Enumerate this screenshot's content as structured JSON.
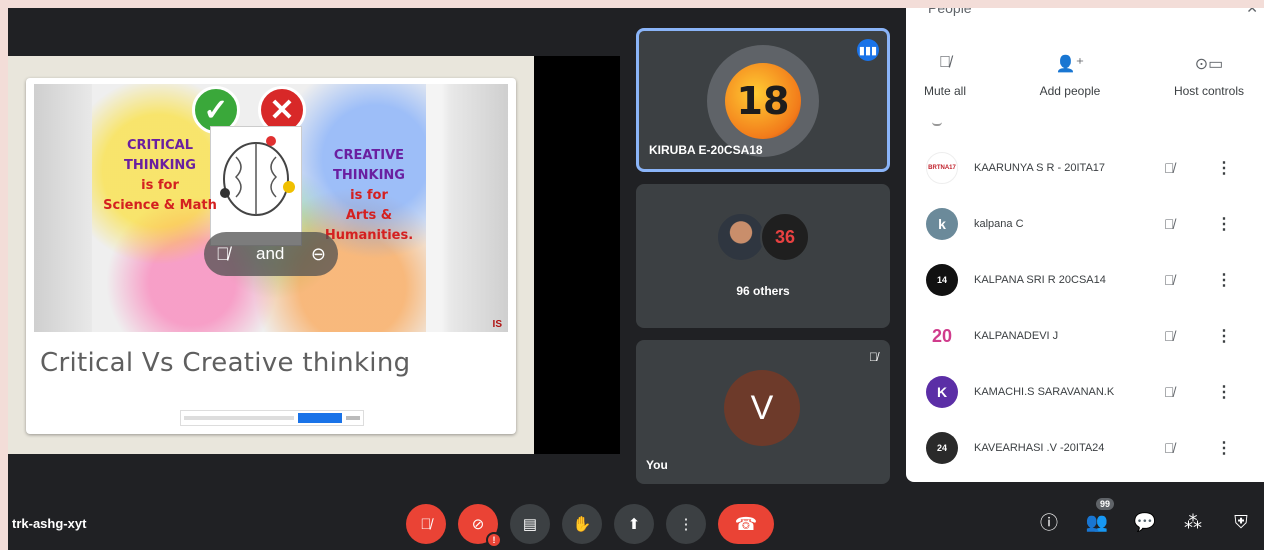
{
  "meeting": {
    "code": "trk-ashg-xyt"
  },
  "presentation": {
    "left_lines": [
      "CRITICAL",
      "THINKING",
      "is for",
      "Science & Math"
    ],
    "right_lines": [
      "CREATIVE",
      "THINKING",
      "is for",
      "Arts &",
      "Humanities."
    ],
    "pill_label": "and",
    "corner_mark": "IS",
    "title": "Critical Vs Creative thinking"
  },
  "tiles": {
    "speaker": {
      "name": "KIRUBA E-20CSA18",
      "avatar_text": "18"
    },
    "others": {
      "label": "96 others",
      "avatar_text": "36"
    },
    "self": {
      "name": "You",
      "avatar_letter": "V"
    }
  },
  "people_panel": {
    "title": "People",
    "actions": [
      {
        "label": "Mute all",
        "icon": "mic-off-icon"
      },
      {
        "label": "Add people",
        "icon": "person-add-icon"
      },
      {
        "label": "Host controls",
        "icon": "toggle-icon"
      }
    ],
    "participants": [
      {
        "name": "KAARUNYA S R - 20ITA17",
        "avatar": "BRTNA17",
        "color": "#ffffff",
        "text_color": "#c0202b"
      },
      {
        "name": "kalpana C",
        "avatar": "k",
        "color": "#6b8a9a",
        "text_color": "#ffffff"
      },
      {
        "name": "KALPANA SRI R 20CSA14",
        "avatar": "14",
        "color": "#111111",
        "text_color": "#ffffff"
      },
      {
        "name": "KALPANADEVI J",
        "avatar": "20",
        "color": "#ffffff",
        "text_color": "#d03c8c"
      },
      {
        "name": "KAMACHI.S SARAVANAN.K",
        "avatar": "K",
        "color": "#5b2ea6",
        "text_color": "#ffffff"
      },
      {
        "name": "KAVEARHASI .V -20ITA24",
        "avatar": "24",
        "color": "#2a2a2a",
        "text_color": "#ffffff"
      }
    ]
  },
  "controls": {
    "people_count": "99"
  },
  "colors": {
    "background": "#202124",
    "tile": "#3c4043",
    "active_border": "#8ab4f8",
    "danger": "#ea4335",
    "accent": "#1a73e8"
  }
}
